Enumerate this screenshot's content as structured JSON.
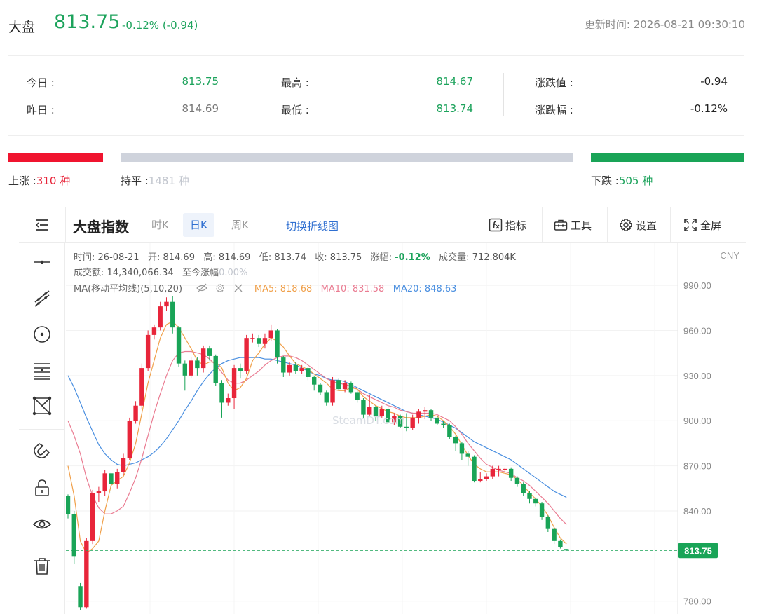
{
  "header": {
    "name": "大盘",
    "price": "813.75",
    "change": "-0.12% (-0.94)",
    "update_label": "更新时间:",
    "update_time": "2026-08-21 09:30:10"
  },
  "stats": {
    "today_label": "今日 :",
    "today_value": "813.75",
    "yesterday_label": "昨日 :",
    "yesterday_value": "814.69",
    "high_label": "最高 :",
    "high_value": "814.67",
    "low_label": "最低 :",
    "low_value": "813.74",
    "chg_val_label": "涨跌值 :",
    "chg_val_value": "-0.94",
    "chg_pct_label": "涨跌幅 :",
    "chg_pct_value": "-0.12%"
  },
  "breadth": {
    "up_label": "上涨 :",
    "up_value": "310 种",
    "flat_label": "持平 :",
    "flat_value": "1481 种",
    "down_label": "下跌 :",
    "down_value": "505 种"
  },
  "toolbar": {
    "title": "大盘指数",
    "tabs": [
      "时K",
      "日K",
      "周K"
    ],
    "active_tab": "日K",
    "switch_label": "切换折线图",
    "indicator_label": "指标",
    "tools_label": "工具",
    "settings_label": "设置",
    "fullscreen_label": "全屏"
  },
  "legend": {
    "time_label": "时间:",
    "time_value": "26-08-21",
    "open_label": "开:",
    "open_value": "814.69",
    "high_label": "高:",
    "high_value": "814.69",
    "low_label": "低:",
    "low_value": "813.74",
    "close_label": "收:",
    "close_value": "813.75",
    "pct_label": "涨幅:",
    "pct_value": "-0.12%",
    "vol_label": "成交量:",
    "vol_value": "712.804K",
    "amount_label": "成交额:",
    "amount_value": "14,340,066.34",
    "cum_label": "至今涨幅",
    "cum_value": "0.00%",
    "ma_label": "MA(移动平均线)(5,10,20)",
    "ma5_label": "MA5: 818.68",
    "ma10_label": "MA10: 831.58",
    "ma20_label": "MA20: 848.63"
  },
  "watermark": "SteamDT.com",
  "colors": {
    "up": "#e8253a",
    "down": "#19a457",
    "ma5": "#f0a04a",
    "ma10": "#ea7c92",
    "ma20": "#4a8fe0",
    "accent": "#2f6fd1"
  },
  "chart_data": {
    "type": "candlestick",
    "currency": "CNY",
    "y_ticks": [
      "990.00",
      "960.00",
      "930.00",
      "900.00",
      "870.00",
      "840.00",
      "780.00"
    ],
    "y_tick_values": [
      990,
      960,
      930,
      900,
      870,
      840,
      780
    ],
    "ylim": [
      771,
      1018
    ],
    "current_label": "813.75",
    "current_value": 813.75,
    "candles": [
      [
        850,
        838,
        851,
        835
      ],
      [
        838,
        810,
        840,
        805
      ],
      [
        790,
        776,
        792,
        774
      ],
      [
        776,
        820,
        822,
        775
      ],
      [
        820,
        852,
        854,
        818
      ],
      [
        852,
        853,
        856,
        846
      ],
      [
        853,
        865,
        867,
        850
      ],
      [
        865,
        858,
        866,
        852
      ],
      [
        858,
        866,
        868,
        855
      ],
      [
        866,
        875,
        878,
        864
      ],
      [
        875,
        900,
        902,
        874
      ],
      [
        900,
        910,
        913,
        898
      ],
      [
        910,
        935,
        938,
        908
      ],
      [
        935,
        957,
        960,
        933
      ],
      [
        957,
        962,
        964,
        954
      ],
      [
        962,
        976,
        979,
        960
      ],
      [
        976,
        979,
        982,
        973
      ],
      [
        979,
        962,
        983,
        958
      ],
      [
        962,
        938,
        963,
        936
      ],
      [
        938,
        930,
        940,
        920
      ],
      [
        930,
        940,
        942,
        928
      ],
      [
        940,
        935,
        942,
        930
      ],
      [
        935,
        948,
        950,
        932
      ],
      [
        948,
        943,
        950,
        940
      ],
      [
        943,
        925,
        944,
        923
      ],
      [
        925,
        912,
        927,
        902
      ],
      [
        912,
        915,
        918,
        910
      ],
      [
        915,
        935,
        937,
        908
      ],
      [
        935,
        933,
        938,
        928
      ],
      [
        933,
        955,
        957,
        931
      ],
      [
        955,
        955,
        958,
        952
      ],
      [
        955,
        951,
        957,
        949
      ],
      [
        951,
        955,
        958,
        948
      ],
      [
        955,
        960,
        964,
        953
      ],
      [
        960,
        942,
        961,
        938
      ],
      [
        942,
        932,
        943,
        929
      ],
      [
        932,
        937,
        939,
        930
      ],
      [
        937,
        933,
        939,
        931
      ],
      [
        933,
        935,
        937,
        931
      ],
      [
        935,
        929,
        936,
        927
      ],
      [
        929,
        924,
        930,
        920
      ],
      [
        924,
        919,
        925,
        917
      ],
      [
        919,
        912,
        920,
        910
      ],
      [
        912,
        927,
        929,
        910
      ],
      [
        927,
        921,
        928,
        920
      ],
      [
        921,
        925,
        927,
        919
      ],
      [
        925,
        919,
        926,
        918
      ],
      [
        919,
        914,
        920,
        912
      ],
      [
        914,
        904,
        915,
        902
      ],
      [
        904,
        909,
        917,
        903
      ],
      [
        909,
        903,
        910,
        900
      ],
      [
        903,
        908,
        910,
        902
      ],
      [
        908,
        899,
        909,
        898
      ],
      [
        899,
        903,
        905,
        897
      ],
      [
        903,
        896,
        904,
        895
      ],
      [
        896,
        895,
        905,
        893
      ],
      [
        895,
        902,
        904,
        894
      ],
      [
        902,
        906,
        908,
        898
      ],
      [
        906,
        907,
        909,
        901
      ],
      [
        907,
        902,
        908,
        900
      ],
      [
        902,
        898,
        903,
        897
      ],
      [
        898,
        897,
        900,
        895
      ],
      [
        897,
        889,
        898,
        888
      ],
      [
        889,
        885,
        890,
        880
      ],
      [
        885,
        878,
        886,
        874
      ],
      [
        878,
        876,
        880,
        870
      ],
      [
        876,
        860,
        877,
        859
      ],
      [
        860,
        861,
        866,
        859
      ],
      [
        861,
        863,
        865,
        860
      ],
      [
        863,
        868,
        870,
        861
      ],
      [
        868,
        868,
        870,
        863
      ],
      [
        868,
        868,
        869,
        866
      ],
      [
        868,
        862,
        869,
        860
      ],
      [
        862,
        858,
        863,
        856
      ],
      [
        858,
        852,
        859,
        850
      ],
      [
        852,
        848,
        853,
        845
      ],
      [
        848,
        845,
        849,
        843
      ],
      [
        845,
        836,
        846,
        834
      ],
      [
        836,
        828,
        837,
        826
      ],
      [
        828,
        820,
        829,
        818
      ],
      [
        820,
        816,
        821,
        815
      ],
      [
        814.69,
        813.75,
        814.69,
        813.74
      ]
    ],
    "ma5": [
      [
        0,
        870
      ],
      [
        1,
        850
      ],
      [
        2,
        820
      ],
      [
        3,
        812
      ],
      [
        4,
        815
      ],
      [
        5,
        820
      ],
      [
        6,
        840
      ],
      [
        7,
        857
      ],
      [
        8,
        860
      ],
      [
        9,
        863
      ],
      [
        10,
        872
      ],
      [
        11,
        885
      ],
      [
        12,
        905
      ],
      [
        13,
        925
      ],
      [
        14,
        940
      ],
      [
        15,
        955
      ],
      [
        16,
        964
      ],
      [
        17,
        966
      ],
      [
        18,
        962
      ],
      [
        19,
        955
      ],
      [
        20,
        948
      ],
      [
        21,
        940
      ],
      [
        22,
        937
      ],
      [
        23,
        939
      ],
      [
        24,
        939
      ],
      [
        25,
        935
      ],
      [
        26,
        925
      ],
      [
        27,
        920
      ],
      [
        28,
        922
      ],
      [
        29,
        928
      ],
      [
        30,
        940
      ],
      [
        31,
        945
      ],
      [
        32,
        951
      ],
      [
        33,
        955
      ],
      [
        34,
        953
      ],
      [
        35,
        949
      ],
      [
        36,
        943
      ],
      [
        37,
        938
      ],
      [
        38,
        936
      ],
      [
        39,
        934
      ],
      [
        40,
        931
      ],
      [
        41,
        928
      ],
      [
        42,
        925
      ],
      [
        43,
        921
      ],
      [
        44,
        920
      ],
      [
        45,
        920
      ],
      [
        46,
        922
      ],
      [
        47,
        921
      ],
      [
        48,
        916
      ],
      [
        49,
        913
      ],
      [
        50,
        910
      ],
      [
        51,
        908
      ],
      [
        52,
        906
      ],
      [
        53,
        905
      ],
      [
        54,
        903
      ],
      [
        55,
        902
      ],
      [
        56,
        902
      ],
      [
        57,
        902
      ],
      [
        58,
        903
      ],
      [
        59,
        904
      ],
      [
        60,
        903
      ],
      [
        61,
        900
      ],
      [
        62,
        896
      ],
      [
        63,
        891
      ],
      [
        64,
        884
      ],
      [
        65,
        877
      ],
      [
        66,
        871
      ],
      [
        67,
        868
      ],
      [
        68,
        866
      ],
      [
        69,
        866
      ],
      [
        70,
        866
      ],
      [
        71,
        865
      ],
      [
        72,
        864
      ],
      [
        73,
        861
      ],
      [
        74,
        857
      ],
      [
        75,
        852
      ],
      [
        76,
        848
      ],
      [
        77,
        843
      ],
      [
        78,
        837
      ],
      [
        79,
        829
      ],
      [
        80,
        822
      ],
      [
        81,
        818
      ]
    ],
    "ma10": [
      [
        0,
        900
      ],
      [
        1,
        890
      ],
      [
        2,
        878
      ],
      [
        3,
        862
      ],
      [
        4,
        850
      ],
      [
        5,
        842
      ],
      [
        6,
        838
      ],
      [
        7,
        838
      ],
      [
        8,
        840
      ],
      [
        9,
        843
      ],
      [
        10,
        852
      ],
      [
        11,
        862
      ],
      [
        12,
        875
      ],
      [
        13,
        890
      ],
      [
        14,
        905
      ],
      [
        15,
        918
      ],
      [
        16,
        930
      ],
      [
        17,
        940
      ],
      [
        18,
        945
      ],
      [
        19,
        946
      ],
      [
        20,
        946
      ],
      [
        21,
        945
      ],
      [
        22,
        944
      ],
      [
        23,
        941
      ],
      [
        24,
        937
      ],
      [
        25,
        932
      ],
      [
        26,
        927
      ],
      [
        27,
        925
      ],
      [
        28,
        925
      ],
      [
        29,
        927
      ],
      [
        30,
        930
      ],
      [
        31,
        933
      ],
      [
        32,
        937
      ],
      [
        33,
        940
      ],
      [
        34,
        942
      ],
      [
        35,
        943
      ],
      [
        36,
        943
      ],
      [
        37,
        942
      ],
      [
        38,
        940
      ],
      [
        39,
        937
      ],
      [
        40,
        934
      ],
      [
        41,
        931
      ],
      [
        42,
        928
      ],
      [
        43,
        926
      ],
      [
        44,
        925
      ],
      [
        45,
        924
      ],
      [
        46,
        923
      ],
      [
        47,
        921
      ],
      [
        48,
        918
      ],
      [
        49,
        916
      ],
      [
        50,
        914
      ],
      [
        51,
        912
      ],
      [
        52,
        910
      ],
      [
        53,
        909
      ],
      [
        54,
        907
      ],
      [
        55,
        906
      ],
      [
        56,
        905
      ],
      [
        57,
        905
      ],
      [
        58,
        905
      ],
      [
        59,
        905
      ],
      [
        60,
        904
      ],
      [
        61,
        902
      ],
      [
        62,
        900
      ],
      [
        63,
        896
      ],
      [
        64,
        891
      ],
      [
        65,
        885
      ],
      [
        66,
        880
      ],
      [
        67,
        875
      ],
      [
        68,
        871
      ],
      [
        69,
        869
      ],
      [
        70,
        867
      ],
      [
        71,
        866
      ],
      [
        72,
        865
      ],
      [
        73,
        862
      ],
      [
        74,
        860
      ],
      [
        75,
        857
      ],
      [
        76,
        853
      ],
      [
        77,
        849
      ],
      [
        78,
        845
      ],
      [
        79,
        840
      ],
      [
        80,
        835
      ],
      [
        81,
        831
      ]
    ],
    "ma20": [
      [
        0,
        930
      ],
      [
        1,
        922
      ],
      [
        2,
        912
      ],
      [
        3,
        902
      ],
      [
        4,
        893
      ],
      [
        5,
        884
      ],
      [
        6,
        878
      ],
      [
        7,
        874
      ],
      [
        8,
        871
      ],
      [
        9,
        870
      ],
      [
        10,
        871
      ],
      [
        11,
        872
      ],
      [
        12,
        874
      ],
      [
        13,
        876
      ],
      [
        14,
        879
      ],
      [
        15,
        883
      ],
      [
        16,
        888
      ],
      [
        17,
        894
      ],
      [
        18,
        900
      ],
      [
        19,
        907
      ],
      [
        20,
        913
      ],
      [
        21,
        920
      ],
      [
        22,
        926
      ],
      [
        23,
        931
      ],
      [
        24,
        935
      ],
      [
        25,
        938
      ],
      [
        26,
        940
      ],
      [
        27,
        941
      ],
      [
        28,
        942
      ],
      [
        29,
        942
      ],
      [
        30,
        942
      ],
      [
        31,
        942
      ],
      [
        32,
        941
      ],
      [
        33,
        941
      ],
      [
        34,
        940
      ],
      [
        35,
        939
      ],
      [
        36,
        938
      ],
      [
        37,
        937
      ],
      [
        38,
        935
      ],
      [
        39,
        933
      ],
      [
        40,
        931
      ],
      [
        41,
        930
      ],
      [
        42,
        928
      ],
      [
        43,
        927
      ],
      [
        44,
        927
      ],
      [
        45,
        926
      ],
      [
        46,
        924
      ],
      [
        47,
        922
      ],
      [
        48,
        920
      ],
      [
        49,
        918
      ],
      [
        50,
        916
      ],
      [
        51,
        914
      ],
      [
        52,
        912
      ],
      [
        53,
        910
      ],
      [
        54,
        908
      ],
      [
        55,
        906
      ],
      [
        56,
        905
      ],
      [
        57,
        904
      ],
      [
        58,
        903
      ],
      [
        59,
        902
      ],
      [
        60,
        901
      ],
      [
        61,
        899
      ],
      [
        62,
        897
      ],
      [
        63,
        895
      ],
      [
        64,
        892
      ],
      [
        65,
        889
      ],
      [
        66,
        886
      ],
      [
        67,
        884
      ],
      [
        68,
        882
      ],
      [
        69,
        880
      ],
      [
        70,
        878
      ],
      [
        71,
        876
      ],
      [
        72,
        874
      ],
      [
        73,
        871
      ],
      [
        74,
        868
      ],
      [
        75,
        865
      ],
      [
        76,
        862
      ],
      [
        77,
        859
      ],
      [
        78,
        856
      ],
      [
        79,
        853
      ],
      [
        80,
        851
      ],
      [
        81,
        849
      ]
    ]
  }
}
